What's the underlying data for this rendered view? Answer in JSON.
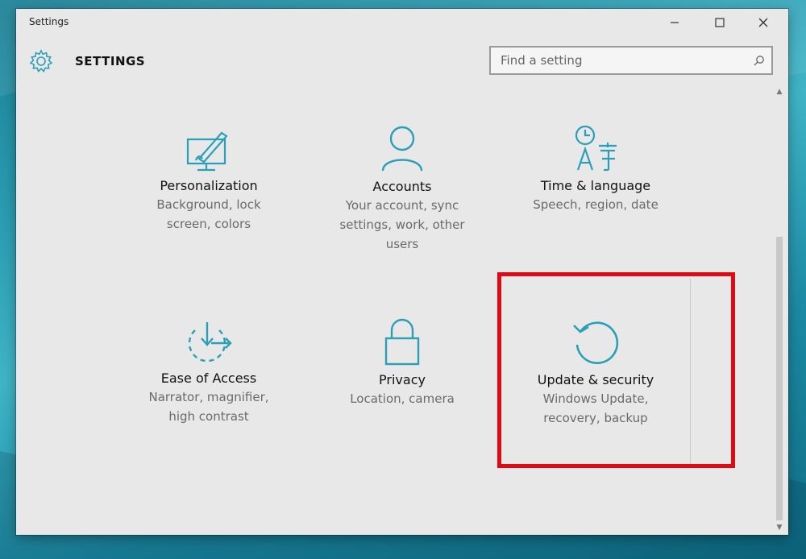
{
  "window": {
    "title": "Settings"
  },
  "header": {
    "title": "SETTINGS"
  },
  "search": {
    "placeholder": "Find a setting"
  },
  "tiles": [
    {
      "title": "Personalization",
      "desc_lines": [
        "Background, lock",
        "screen, colors"
      ]
    },
    {
      "title": "Accounts",
      "desc_lines": [
        "Your account, sync",
        "settings, work, other",
        "users"
      ]
    },
    {
      "title": "Time & language",
      "desc_lines": [
        "Speech, region, date"
      ]
    },
    {
      "title": "Ease of Access",
      "desc_lines": [
        "Narrator, magnifier,",
        "high contrast"
      ]
    },
    {
      "title": "Privacy",
      "desc_lines": [
        "Location, camera"
      ]
    },
    {
      "title": "Update & security",
      "desc_lines": [
        "Windows Update,",
        "recovery, backup"
      ]
    }
  ],
  "colors": {
    "accent": "#2aa0b8",
    "highlight": "#e20a12"
  }
}
